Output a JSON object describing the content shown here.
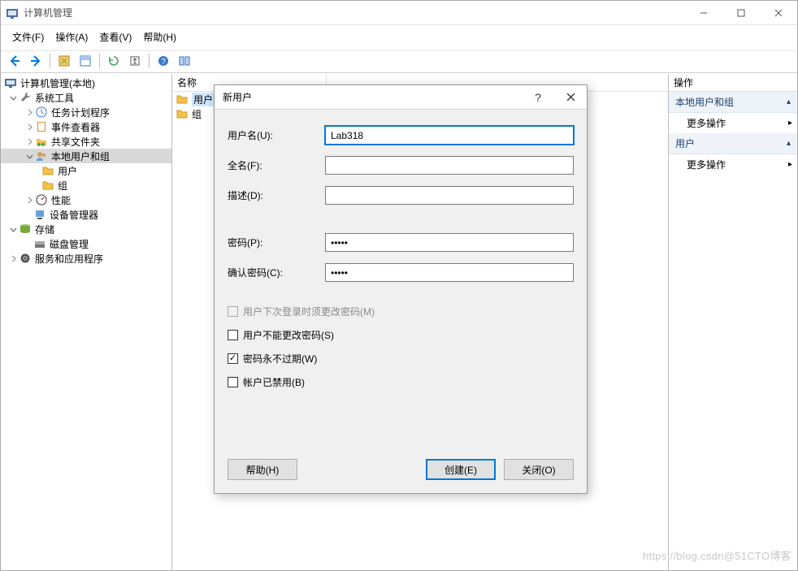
{
  "window": {
    "title": "计算机管理"
  },
  "menu": {
    "file": "文件(F)",
    "action": "操作(A)",
    "view": "查看(V)",
    "help": "帮助(H)"
  },
  "tree": {
    "root": "计算机管理(本地)",
    "system_tools": "系统工具",
    "task_scheduler": "任务计划程序",
    "event_viewer": "事件查看器",
    "shared_folders": "共享文件夹",
    "local_users_groups": "本地用户和组",
    "users": "用户",
    "groups": "组",
    "performance": "性能",
    "device_manager": "设备管理器",
    "storage": "存储",
    "disk_management": "磁盘管理",
    "services_apps": "服务和应用程序"
  },
  "middle": {
    "header_name": "名称",
    "items": [
      {
        "label": "用户",
        "selected": true
      },
      {
        "label": "组",
        "selected": false
      }
    ]
  },
  "actions": {
    "header": "操作",
    "sections": [
      {
        "title": "本地用户和组",
        "items": [
          {
            "label": "更多操作",
            "hasSubmenu": true
          }
        ]
      },
      {
        "title": "用户",
        "items": [
          {
            "label": "更多操作",
            "hasSubmenu": true
          }
        ]
      }
    ]
  },
  "dialog": {
    "title": "新用户",
    "labels": {
      "username": "用户名(U):",
      "fullname": "全名(F):",
      "description": "描述(D):",
      "password": "密码(P):",
      "confirm_password": "确认密码(C):"
    },
    "values": {
      "username": "Lab318",
      "fullname": "",
      "description": "",
      "password": "•••••",
      "confirm_password": "•••••"
    },
    "checkboxes": {
      "must_change": {
        "label": "用户下次登录时须更改密码(M)",
        "checked": false,
        "enabled": false
      },
      "cannot_change": {
        "label": "用户不能更改密码(S)",
        "checked": false,
        "enabled": true
      },
      "never_expires": {
        "label": "密码永不过期(W)",
        "checked": true,
        "enabled": true
      },
      "disabled": {
        "label": "帐户已禁用(B)",
        "checked": false,
        "enabled": true
      }
    },
    "buttons": {
      "help": "帮助(H)",
      "create": "创建(E)",
      "close": "关闭(O)"
    }
  },
  "watermark": "https://blog.csdn@51CTO博客"
}
